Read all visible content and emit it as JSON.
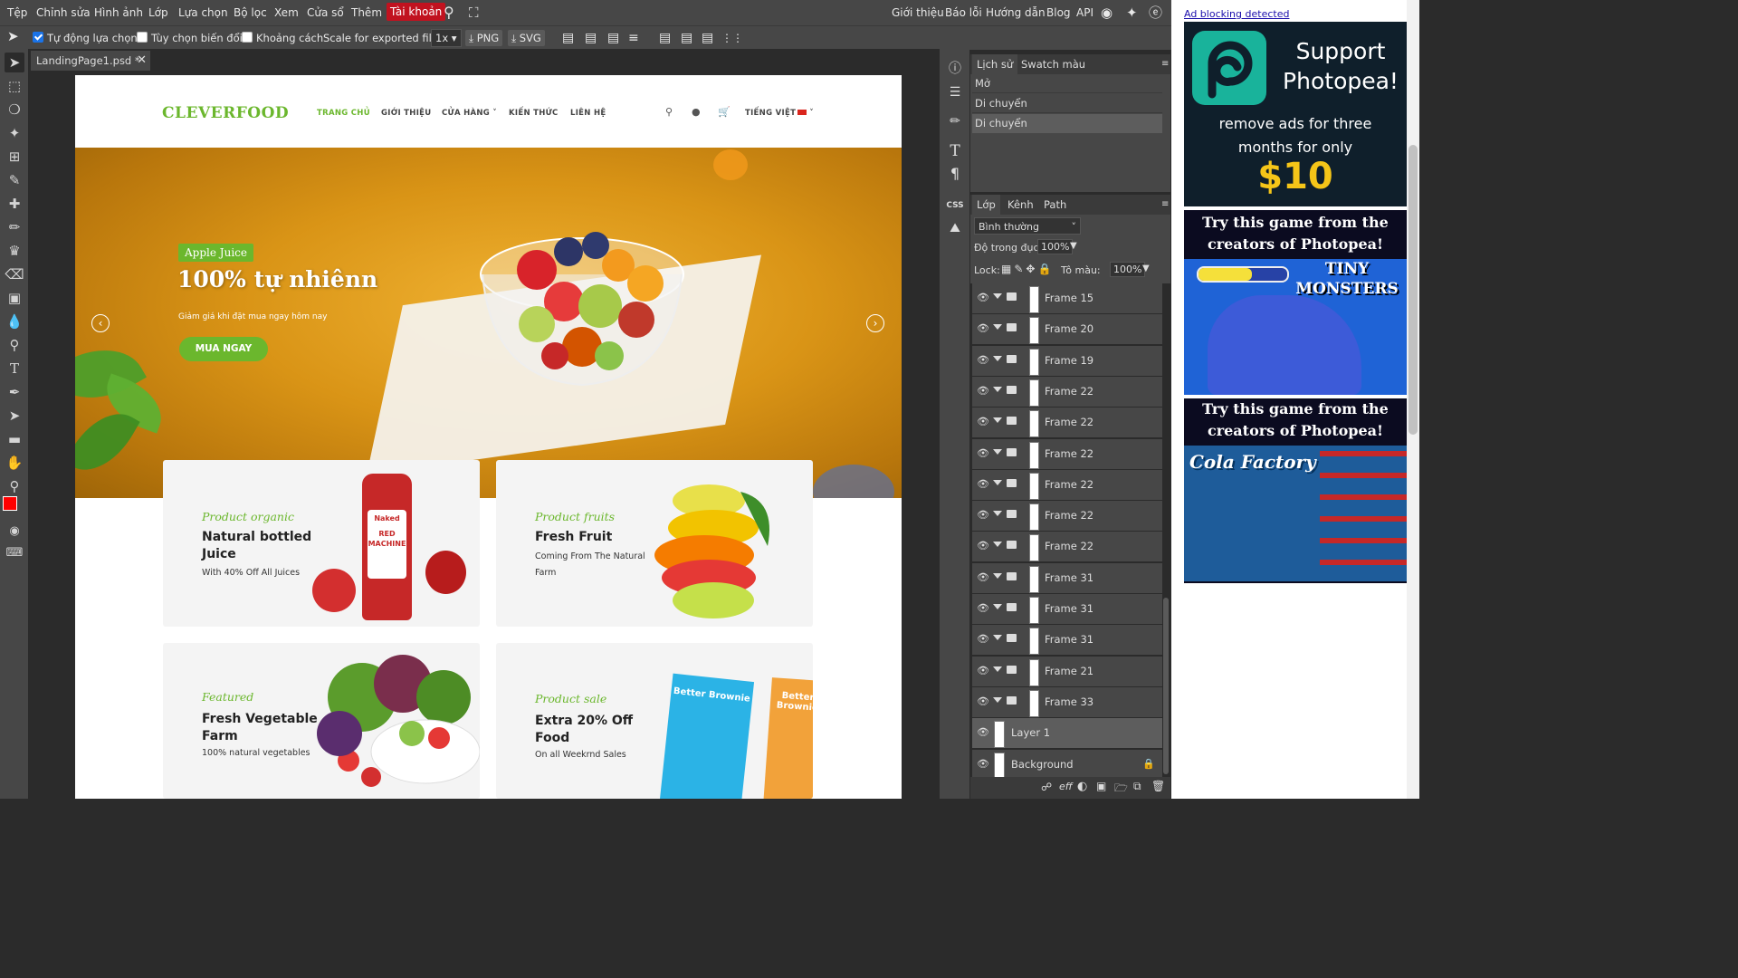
{
  "menu": {
    "items": [
      "Tệp",
      "Chỉnh sửa",
      "Hình ảnh",
      "Lớp",
      "Lựa chọn",
      "Bộ lọc",
      "Xem",
      "Cửa sổ",
      "Thêm",
      "Tài khoản"
    ],
    "right": [
      "Giới thiệu",
      "Báo lỗi",
      "Hướng dẫn",
      "Blog",
      "API"
    ]
  },
  "options": {
    "auto_select": "Tự động lựa chọn",
    "transform": "Tùy chọn biến đổi",
    "distances": "Khoảng cách",
    "scale_label": "Scale for exported files:",
    "scale_value": "1x",
    "png": "PNG",
    "svg": "SVG"
  },
  "document": {
    "tab_title": "LandingPage1.psd *"
  },
  "site": {
    "logo": "CLEVERFOOD",
    "nav": [
      "TRANG CHỦ",
      "GIỚI THIỆU",
      "CỬA HÀNG",
      "KIẾN THỨC",
      "LIÊN HỆ"
    ],
    "lang": "TIẾNG VIỆT",
    "hero": {
      "badge": "Apple Juice",
      "title": "100% tự nhiênn",
      "subtitle": "Giảm giá khi đặt mua ngay hôm nay",
      "button": "MUA NGAY"
    },
    "cards": [
      {
        "kicker": "Product organic",
        "title": "Natural bottled Juice",
        "sub": "With 40% Off All Juices"
      },
      {
        "kicker": "Product fruits",
        "title": "Fresh Fruit",
        "sub": "Coming From The Natural Farm"
      },
      {
        "kicker": "Featured",
        "title": "Fresh Vegetable Farm",
        "sub": "100% natural vegetables"
      },
      {
        "kicker": "Product sale",
        "title": "Extra 20% Off Food",
        "sub": "On all Weekrnd Sales"
      }
    ],
    "bottle_label": "Naked",
    "bottle_name": "RED MACHINE",
    "brownie": "Better Brownie"
  },
  "history_panel": {
    "tabs": [
      "Lịch sử",
      "Swatch màu"
    ],
    "items": [
      "Mở",
      "Di chuyển",
      "Di chuyển"
    ]
  },
  "layers_panel": {
    "tabs": [
      "Lớp",
      "Kênh",
      "Path"
    ],
    "blend_mode": "Bình thường",
    "opacity_label": "Độ trong đục:",
    "opacity_value": "100%",
    "lock_label": "Lock:",
    "fill_label": "Tô màu:",
    "fill_value": "100%",
    "layers": [
      {
        "name": "Frame 15",
        "type": "group"
      },
      {
        "name": "Frame 20",
        "type": "group"
      },
      {
        "name": "Frame 19",
        "type": "group"
      },
      {
        "name": "Frame 22",
        "type": "group"
      },
      {
        "name": "Frame 22",
        "type": "group"
      },
      {
        "name": "Frame 22",
        "type": "group"
      },
      {
        "name": "Frame 22",
        "type": "group"
      },
      {
        "name": "Frame 22",
        "type": "group"
      },
      {
        "name": "Frame 22",
        "type": "group"
      },
      {
        "name": "Frame 31",
        "type": "group"
      },
      {
        "name": "Frame 31",
        "type": "group"
      },
      {
        "name": "Frame 31",
        "type": "group"
      },
      {
        "name": "Frame 21",
        "type": "group"
      },
      {
        "name": "Frame 33",
        "type": "group"
      },
      {
        "name": "Layer 1",
        "type": "layer",
        "selected": true
      },
      {
        "name": "Background",
        "type": "layer",
        "locked": true
      }
    ],
    "bottom_icons": [
      "link-icon",
      "eff",
      "mask-icon",
      "adjustment-icon",
      "folder-icon",
      "new-layer-icon",
      "trash-icon"
    ]
  },
  "ad": {
    "notice": "Ad blocking detected",
    "support_title": "Support Photopea!",
    "support_text": "remove ads for three months for only",
    "price": "$10",
    "game_head": "Try this game from the creators of Photopea!",
    "game1": "TINY MONSTERS",
    "game2": "Cola Factory"
  },
  "colors": {
    "accent_green": "#6bb72d",
    "panel_bg": "#474747",
    "account_red": "#c1121f",
    "fg_color": "#ff0000"
  }
}
